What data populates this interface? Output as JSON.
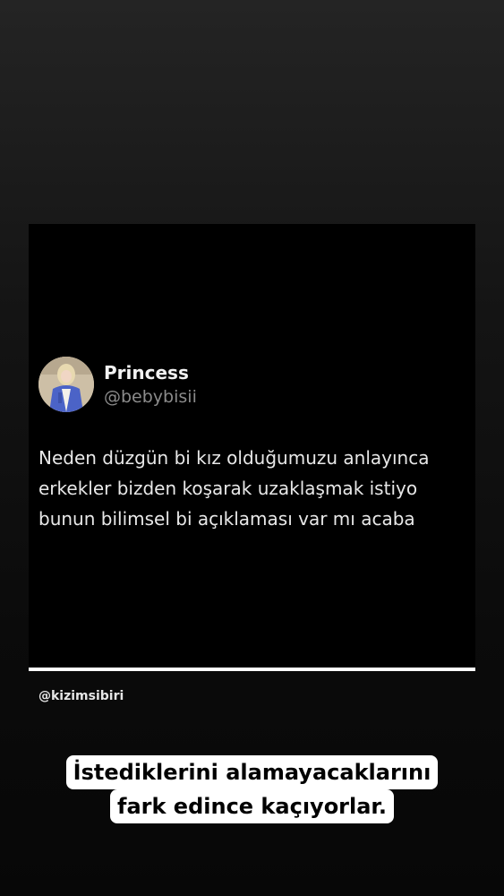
{
  "post": {
    "display_name": "Princess",
    "handle": "@bebybisii",
    "text_lines": [
      "Neden düzgün bi kız olduğumuzu anlayınca",
      "erkekler bizden koşarak uzaklaşmak istiyo",
      "bunun bilimsel bi açıklaması var mı acaba"
    ]
  },
  "watermark": "@kizimsibiri",
  "caption": {
    "line1": "İstediklerini alamayacaklarını",
    "line2": "fark edince kaçıyorlar."
  },
  "colors": {
    "card_background": "#000000",
    "caption_background": "#ffffff",
    "caption_text": "#000000",
    "handle_text": "#8b8b8b"
  }
}
